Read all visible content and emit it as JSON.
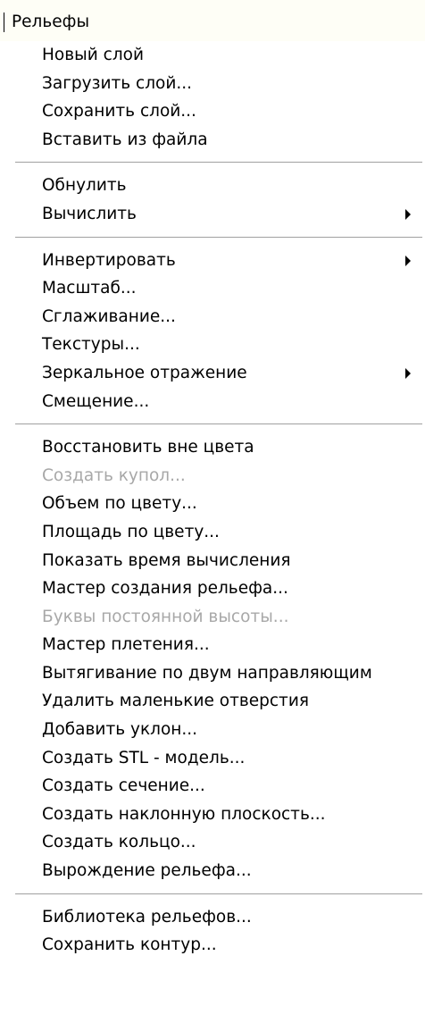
{
  "menubar": {
    "title": "Рельефы"
  },
  "menu": {
    "groups": [
      [
        {
          "label": "Новый слой",
          "enabled": true,
          "submenu": false
        },
        {
          "label": "Загрузить слой...",
          "enabled": true,
          "submenu": false
        },
        {
          "label": "Сохранить слой...",
          "enabled": true,
          "submenu": false
        },
        {
          "label": "Вставить из файла",
          "enabled": true,
          "submenu": false
        }
      ],
      [
        {
          "label": "Обнулить",
          "enabled": true,
          "submenu": false
        },
        {
          "label": "Вычислить",
          "enabled": true,
          "submenu": true
        }
      ],
      [
        {
          "label": "Инвертировать",
          "enabled": true,
          "submenu": true
        },
        {
          "label": "Масштаб...",
          "enabled": true,
          "submenu": false
        },
        {
          "label": "Сглаживание...",
          "enabled": true,
          "submenu": false
        },
        {
          "label": "Текстуры...",
          "enabled": true,
          "submenu": false
        },
        {
          "label": "Зеркальное отражение",
          "enabled": true,
          "submenu": true
        },
        {
          "label": "Смещение...",
          "enabled": true,
          "submenu": false
        }
      ],
      [
        {
          "label": "Восстановить вне цвета",
          "enabled": true,
          "submenu": false
        },
        {
          "label": "Создать купол...",
          "enabled": false,
          "submenu": false
        },
        {
          "label": "Объем по цвету...",
          "enabled": true,
          "submenu": false
        },
        {
          "label": "Площадь по цвету...",
          "enabled": true,
          "submenu": false
        },
        {
          "label": "Показать время вычисления",
          "enabled": true,
          "submenu": false
        },
        {
          "label": "Мастер создания рельефа...",
          "enabled": true,
          "submenu": false
        },
        {
          "label": "Буквы постоянной высоты...",
          "enabled": false,
          "submenu": false
        },
        {
          "label": "Мастер плетения...",
          "enabled": true,
          "submenu": false
        },
        {
          "label": "Вытягивание по двум направляющим",
          "enabled": true,
          "submenu": false
        },
        {
          "label": "Удалить маленькие отверстия",
          "enabled": true,
          "submenu": false
        },
        {
          "label": "Добавить уклон...",
          "enabled": true,
          "submenu": false
        },
        {
          "label": "Создать STL - модель...",
          "enabled": true,
          "submenu": false
        },
        {
          "label": "Создать сечение...",
          "enabled": true,
          "submenu": false
        },
        {
          "label": "Создать наклонную плоскость...",
          "enabled": true,
          "submenu": false
        },
        {
          "label": "Создать кольцо...",
          "enabled": true,
          "submenu": false
        },
        {
          "label": "Вырождение рельефа...",
          "enabled": true,
          "submenu": false
        }
      ],
      [
        {
          "label": "Библиотека рельефов...",
          "enabled": true,
          "submenu": false
        },
        {
          "label": "Сохранить контур...",
          "enabled": true,
          "submenu": false
        }
      ]
    ]
  }
}
